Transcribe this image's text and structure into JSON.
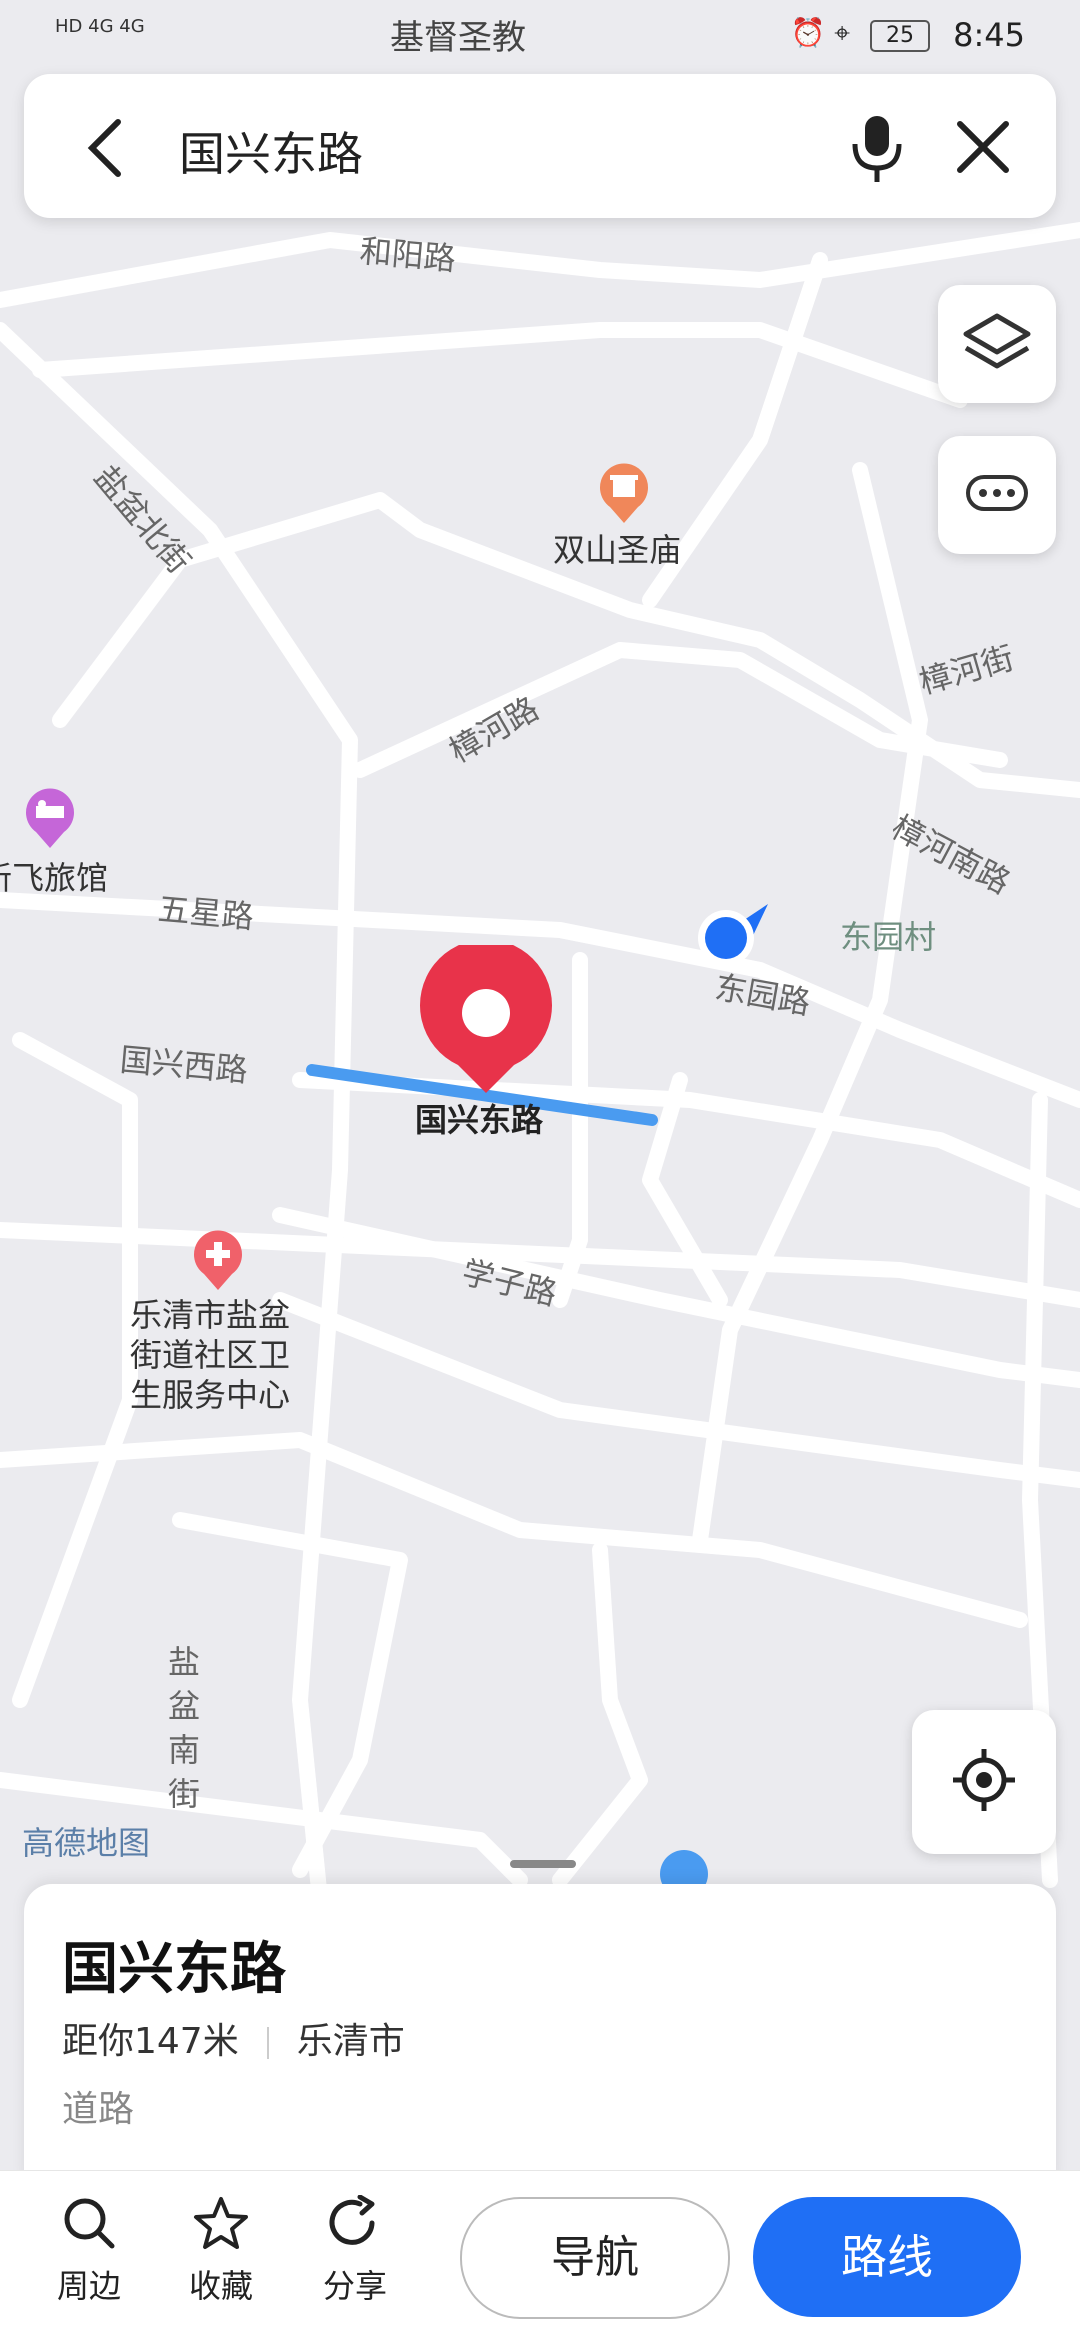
{
  "status_bar": {
    "network_left": "HD 4G 4G",
    "time": "8:45",
    "battery": "25",
    "top_label": "基督圣教"
  },
  "search": {
    "query": "国兴东路"
  },
  "map_labels": {
    "heyang_road": "和阳路",
    "yanpen_north": "盐盆北街",
    "shuangshan_temple": "双山圣庙",
    "zhanghe_road": "樟河路",
    "zhanghe_street": "樟河街",
    "zhanghe_south": "樟河南路",
    "hotel": "新飞旅馆",
    "wuxing_road": "五星路",
    "dongyuan_village": "东园村",
    "dongyuan_road": "东园路",
    "guoxing_west": "国兴西路",
    "guoxing_east": "国兴东路",
    "xuezi_road": "学子路",
    "health_center": "乐清市盐盆街道社区卫生服务中心",
    "health_line1": "乐清市盐盆",
    "health_line2": "街道社区卫",
    "health_line3": "生服务中心",
    "yanpen_south": "盐盆南街",
    "map_brand": "高德地图"
  },
  "info_card": {
    "title": "国兴东路",
    "distance": "距你147米",
    "city": "乐清市",
    "category": "道路"
  },
  "bottom_bar": {
    "nearby": "周边",
    "favorite": "收藏",
    "share": "分享",
    "navigate": "导航",
    "route": "路线"
  },
  "colors": {
    "accent": "#1f6ff5",
    "pin": "#e8334a",
    "highlight_road": "#4a9bf0",
    "map_bg": "#ebebef"
  }
}
